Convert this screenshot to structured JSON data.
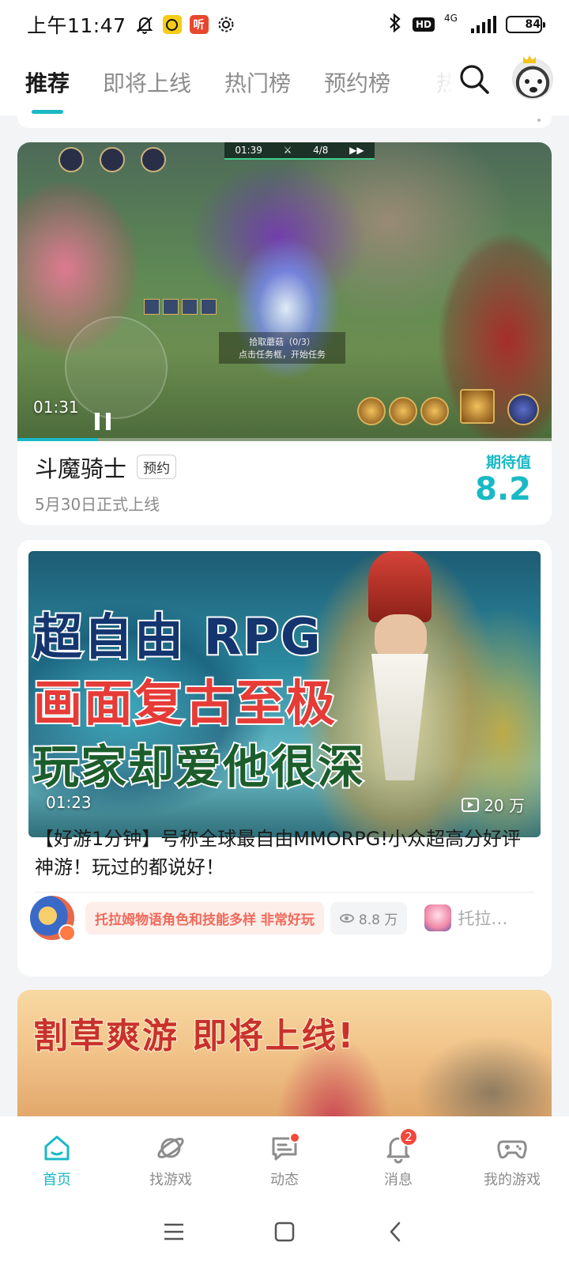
{
  "status_bar": {
    "time": "上午11:47",
    "app_icon_red_text": "听",
    "network_type": "4G",
    "hd_label": "HD",
    "battery": "84",
    "battery_level": 0.84
  },
  "top_nav": {
    "tabs": [
      {
        "label": "推荐",
        "active": true
      },
      {
        "label": "即将上线",
        "active": false
      },
      {
        "label": "热门榜",
        "active": false
      },
      {
        "label": "预约榜",
        "active": false
      }
    ],
    "cut_tab_fragment": "热",
    "icons": {
      "search": "search-icon",
      "avatar": "user-avatar"
    }
  },
  "card1": {
    "video_time": "01:31",
    "video_progress": 0.15,
    "hud": {
      "timer": "01:39",
      "wave": "4/8",
      "quest_title": "拾取蘑菇（0/3）",
      "quest_sub": "点击任务框，开始任务"
    },
    "game_title": "斗魔骑士",
    "tag": "预约",
    "release_text": "5月30日正式上线",
    "expect_label": "期待值",
    "expect_value": "8.2"
  },
  "card2": {
    "cover_lines": [
      "超自由 RPG",
      "画面复古至极",
      "玩家却爱他很深"
    ],
    "video_time": "01:23",
    "video_views": "20 万",
    "title": "【好游1分钟】号称全球最自由MMORPG!小众超高分好评神游！玩过的都说好！",
    "tag_highlight": "托拉姆物语角色和技能多样 非常好玩",
    "view_count": "8.8 万",
    "game_name": "托拉…"
  },
  "card3": {
    "banner_text": "割草爽游 即将上线!"
  },
  "bottom_nav": {
    "items": [
      {
        "label": "首页",
        "icon": "home-icon",
        "active": true
      },
      {
        "label": "找游戏",
        "icon": "planet-icon",
        "active": false
      },
      {
        "label": "动态",
        "icon": "chat-icon",
        "active": false,
        "dot": true
      },
      {
        "label": "消息",
        "icon": "bell-icon",
        "active": false,
        "badge": "2"
      },
      {
        "label": "我的游戏",
        "icon": "gamepad-icon",
        "active": false
      }
    ]
  },
  "system_nav": {
    "icons": [
      "menu-icon",
      "home-square-icon",
      "back-icon"
    ]
  },
  "colors": {
    "accent": "#19b9c5",
    "badge_red": "#f2483a",
    "tag_pink_bg": "#fdeeea",
    "tag_pink_text": "#f0695a"
  }
}
